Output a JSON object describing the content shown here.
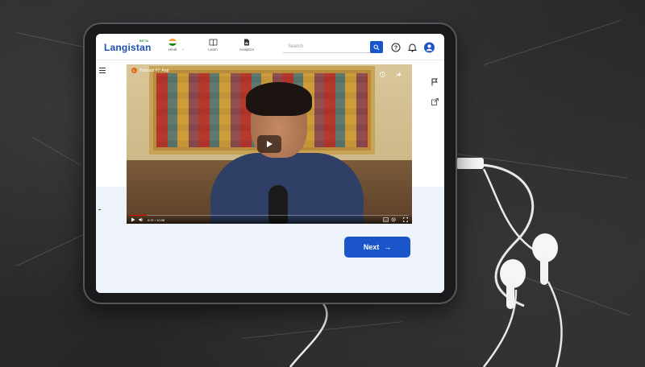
{
  "header": {
    "logo": "Langistan",
    "logo_badge": "BETA",
    "language": "Hindi",
    "nav": [
      {
        "label": "Learn",
        "icon": "book-icon"
      },
      {
        "label": "Analytics",
        "icon": "document-chart-icon"
      }
    ],
    "search_placeholder": "Search"
  },
  "video": {
    "channel_initial": "L",
    "title": "Podcast #7: Aap",
    "time": "0:37 / 10:38",
    "progress": 0.06
  },
  "next_label": "Next",
  "colors": {
    "accent": "#1a56c9",
    "brand": "#1d4fae"
  }
}
